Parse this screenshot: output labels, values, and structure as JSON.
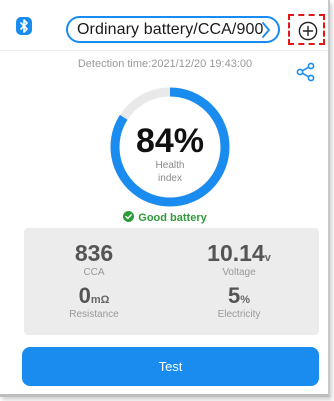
{
  "header": {
    "bluetooth_icon": "bluetooth-icon",
    "battery_selector": {
      "label": "Ordinary battery/CCA/900",
      "chevron_icon": "chevron-right-icon"
    },
    "add_icon": "circle-plus-icon"
  },
  "detection": {
    "time_text": "Detection time:2021/12/20 19:43:00",
    "share_icon": "share-icon"
  },
  "gauge": {
    "percent": 84,
    "percent_text": "84%",
    "label_line1": "Health",
    "label_line2": "index"
  },
  "status": {
    "icon": "check-circle-icon",
    "text": "Good battery"
  },
  "stats": {
    "cca": {
      "value": "836",
      "label": "CCA"
    },
    "voltage": {
      "value": "10.14",
      "unit": "v",
      "label": "Voltage"
    },
    "resistance": {
      "value": "0",
      "unit": "mΩ",
      "label": "Resistance"
    },
    "electricity": {
      "value": "5",
      "unit": "%",
      "label": "Electricity"
    }
  },
  "actions": {
    "test_label": "Test"
  },
  "colors": {
    "accent": "#1a8cf0",
    "good": "#2e9b3a",
    "highlight": "#e01818"
  }
}
